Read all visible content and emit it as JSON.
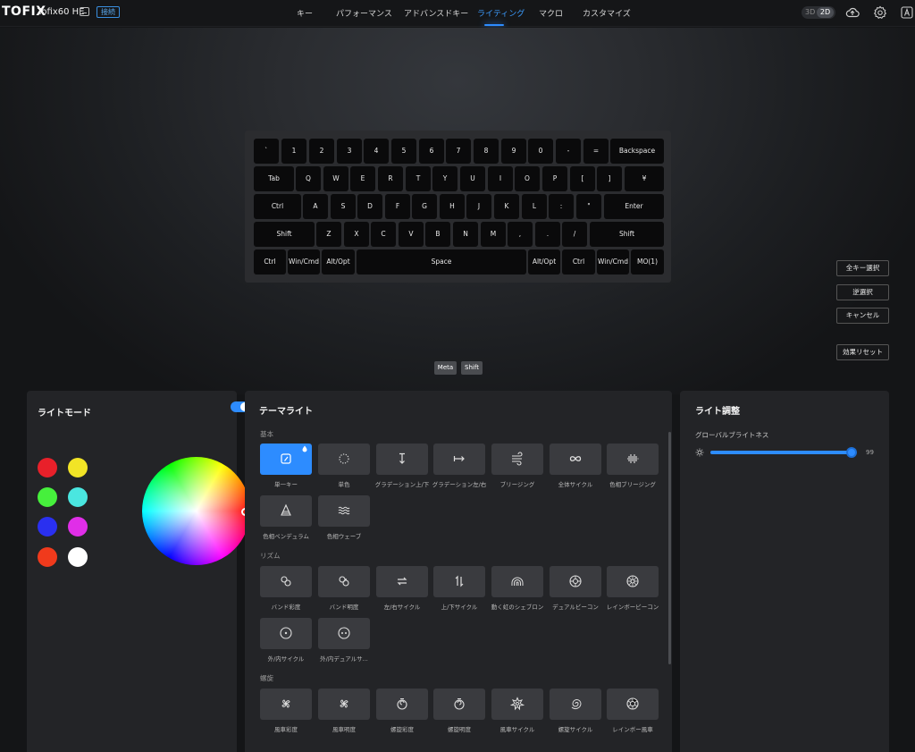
{
  "header": {
    "logo": "TOFIX",
    "device": "Tofix60 HE",
    "status_badge": "接続",
    "nav": [
      {
        "label": "キー",
        "active": false
      },
      {
        "label": "パフォーマンス",
        "active": false
      },
      {
        "label": "アドバンスドキー",
        "active": false
      },
      {
        "label": "ライティング",
        "active": true
      },
      {
        "label": "マクロ",
        "active": false
      },
      {
        "label": "カスタマイズ",
        "active": false
      }
    ],
    "view_3d": "3D",
    "view_2d": "2D"
  },
  "keyboard": {
    "rows": [
      [
        "`",
        "1",
        "2",
        "3",
        "4",
        "5",
        "6",
        "7",
        "8",
        "9",
        "0",
        "-",
        "=",
        "Backspace"
      ],
      [
        "Tab",
        "Q",
        "W",
        "E",
        "R",
        "T",
        "Y",
        "U",
        "I",
        "O",
        "P",
        "[",
        "]",
        "¥"
      ],
      [
        "Ctrl",
        "A",
        "S",
        "D",
        "F",
        "G",
        "H",
        "J",
        "K",
        "L",
        ":",
        "\"",
        "Enter"
      ],
      [
        "Shift",
        "Z",
        "X",
        "C",
        "V",
        "B",
        "N",
        "M",
        ",",
        ".",
        "/",
        "Shift"
      ],
      [
        "Ctrl",
        "Win/Cmd",
        "Alt/Opt",
        "Space",
        "Alt/Opt",
        "Ctrl",
        "Win/Cmd",
        "MO(1)"
      ]
    ],
    "modifiers": [
      "Meta",
      "Shift"
    ]
  },
  "side_buttons": {
    "select_all": "全キー選択",
    "invert": "逆選択",
    "cancel": "キャンセル",
    "reset": "効果リセット"
  },
  "light_mode": {
    "title": "ライトモード",
    "toggle_on": true,
    "swatches": [
      "#e8202a",
      "#f2e426",
      "#46f03c",
      "#4ae6e0",
      "#2a30f0",
      "#e02ee8",
      "#f03a1c",
      "#ffffff"
    ]
  },
  "theme_light": {
    "title": "テーマライト",
    "sections": [
      {
        "label": "基本",
        "items": [
          {
            "label": "単一キー",
            "icon": "single-key-icon",
            "selected": true
          },
          {
            "label": "単色",
            "icon": "dotted-circle-icon"
          },
          {
            "label": "グラデーション上/下",
            "icon": "arrow-vertical-icon"
          },
          {
            "label": "グラデーション左/右",
            "icon": "arrow-right-icon"
          },
          {
            "label": "ブリージング",
            "icon": "breathing-icon"
          },
          {
            "label": "全体サイクル",
            "icon": "infinity-icon"
          },
          {
            "label": "色相ブリージング",
            "icon": "waveform-icon"
          },
          {
            "label": "色相ペンデュラム",
            "icon": "pendulum-icon"
          },
          {
            "label": "色相ウェーブ",
            "icon": "wave-icon"
          }
        ]
      },
      {
        "label": "リズム",
        "items": [
          {
            "label": "バンド彩度",
            "icon": "band-saturation-icon"
          },
          {
            "label": "バンド明度",
            "icon": "band-value-icon"
          },
          {
            "label": "左/右サイクル",
            "icon": "swap-horizontal-icon"
          },
          {
            "label": "上/下サイクル",
            "icon": "swap-vertical-icon"
          },
          {
            "label": "動く虹のシェブロン",
            "icon": "rainbow-icon"
          },
          {
            "label": "デュアルビーコン",
            "icon": "beacon-icon"
          },
          {
            "label": "レインボービーコン",
            "icon": "rainbow-beacon-icon"
          },
          {
            "label": "外/内サイクル",
            "icon": "out-in-icon"
          },
          {
            "label": "外/内デュアルサ...",
            "icon": "out-in-dual-icon"
          }
        ]
      },
      {
        "label": "螺旋",
        "items": [
          {
            "label": "風車彩度",
            "icon": "pinwheel-icon"
          },
          {
            "label": "風車明度",
            "icon": "pinwheel-value-icon"
          },
          {
            "label": "螺旋彩度",
            "icon": "spiral-icon"
          },
          {
            "label": "螺旋明度",
            "icon": "spiral-value-icon"
          },
          {
            "label": "風車サイクル",
            "icon": "pinwheel-cycle-icon"
          },
          {
            "label": "螺旋サイクル",
            "icon": "spiral-cycle-icon"
          },
          {
            "label": "レインボー風車",
            "icon": "rainbow-pinwheel-icon"
          }
        ]
      }
    ]
  },
  "light_adjust": {
    "title": "ライト調整",
    "brightness_label": "グローバルブライトネス",
    "brightness_value": "99",
    "brightness_fraction": 0.99
  }
}
